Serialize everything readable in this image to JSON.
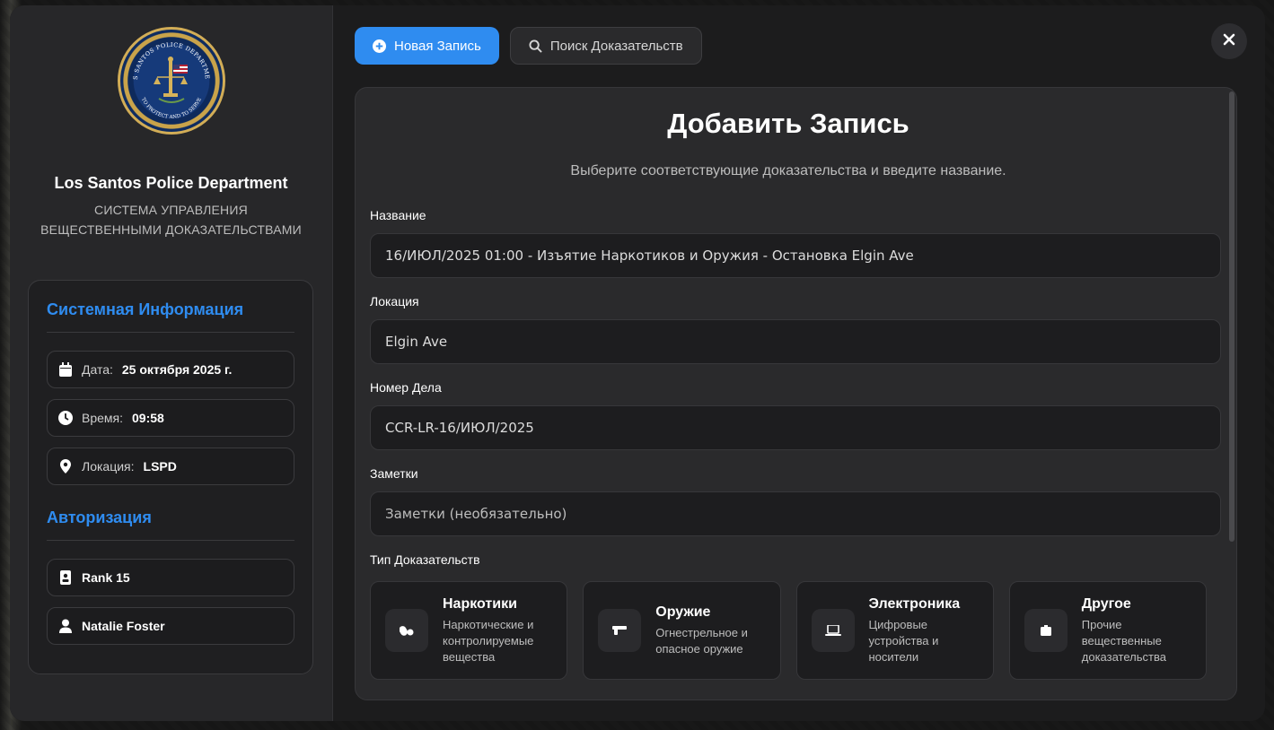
{
  "sidebar": {
    "department_name": "Los Santos Police Department",
    "system_line1": "СИСТЕМА УПРАВЛЕНИЯ",
    "system_line2": "ВЕЩЕСТВЕННЫМИ ДОКАЗАТЕЛЬСТВАМИ",
    "badge_text_top": "LOS SANTOS POLICE DEPARTMENT",
    "badge_text_bottom": "TO PROTECT AND TO SERVE",
    "system_info": {
      "title": "Системная Информация",
      "date_label": "Дата:",
      "date_value": "25 октября 2025 г.",
      "time_label": "Время:",
      "time_value": "09:58",
      "location_label": "Локация:",
      "location_value": "LSPD"
    },
    "auth": {
      "title": "Авторизация",
      "rank": "Rank 15",
      "user": "Natalie Foster"
    }
  },
  "toolbar": {
    "new_record_label": "Новая Запись",
    "search_label": "Поиск Доказательств"
  },
  "form": {
    "title": "Добавить Запись",
    "subtitle": "Выберите соответствующие доказательства и введите название.",
    "name_label": "Название",
    "name_value": "16/ИЮЛ/2025 01:00 - Изъятие Наркотиков и Оружия - Остановка Elgin Ave",
    "location_label": "Локация",
    "location_value": "Elgin Ave",
    "case_label": "Номер Дела",
    "case_value": "CCR-LR-16/ИЮЛ/2025",
    "notes_label": "Заметки",
    "notes_placeholder": "Заметки (необязательно)",
    "evidence_type_label": "Тип Доказательств",
    "evidence_types": [
      {
        "title": "Наркотики",
        "line1": "Наркотические и",
        "line2": "контролируемые",
        "line3": "вещества",
        "icon": "pills-icon"
      },
      {
        "title": "Оружие",
        "line1": "Огнестрельное и",
        "line2": "опасное оружие",
        "line3": "",
        "icon": "gun-icon"
      },
      {
        "title": "Электроника",
        "line1": "Цифровые",
        "line2": "устройства и",
        "line3": "носители",
        "icon": "laptop-icon"
      },
      {
        "title": "Другое",
        "line1": "Прочие",
        "line2": "вещественные",
        "line3": "доказательства",
        "icon": "box-icon"
      }
    ]
  },
  "colors": {
    "accent": "#2f8cf0",
    "background": "#1c1c1d",
    "panel": "#2a2a2c"
  }
}
